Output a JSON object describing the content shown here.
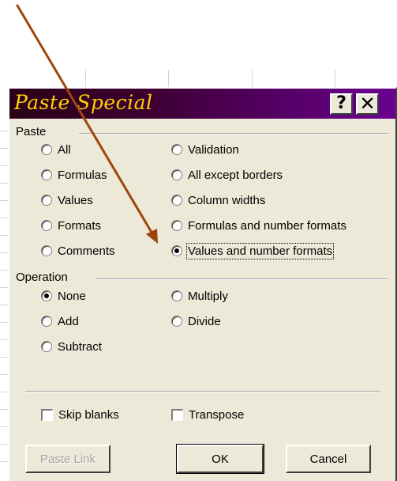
{
  "dialog": {
    "title": "Paste Special",
    "help_label": "?",
    "close_label": "✕"
  },
  "paste": {
    "label": "Paste",
    "options": [
      {
        "label": "All",
        "checked": false
      },
      {
        "label": "Formulas",
        "checked": false
      },
      {
        "label": "Values",
        "checked": false
      },
      {
        "label": "Formats",
        "checked": false
      },
      {
        "label": "Comments",
        "checked": false
      },
      {
        "label": "Validation",
        "checked": false
      },
      {
        "label": "All except borders",
        "checked": false
      },
      {
        "label": "Column widths",
        "checked": false
      },
      {
        "label": "Formulas and number formats",
        "checked": false
      },
      {
        "label": "Values and number formats",
        "checked": true
      }
    ]
  },
  "operation": {
    "label": "Operation",
    "options": [
      {
        "label": "None",
        "checked": true
      },
      {
        "label": "Add",
        "checked": false
      },
      {
        "label": "Subtract",
        "checked": false
      },
      {
        "label": "Multiply",
        "checked": false
      },
      {
        "label": "Divide",
        "checked": false
      }
    ]
  },
  "checkboxes": {
    "skip_blanks": {
      "label": "Skip blanks",
      "checked": false
    },
    "transpose": {
      "label": "Transpose",
      "checked": false
    }
  },
  "buttons": {
    "paste_link": "Paste Link",
    "ok": "OK",
    "cancel": "Cancel"
  },
  "colors": {
    "title_text": "#ffd200",
    "arrow": "#a0440d"
  }
}
